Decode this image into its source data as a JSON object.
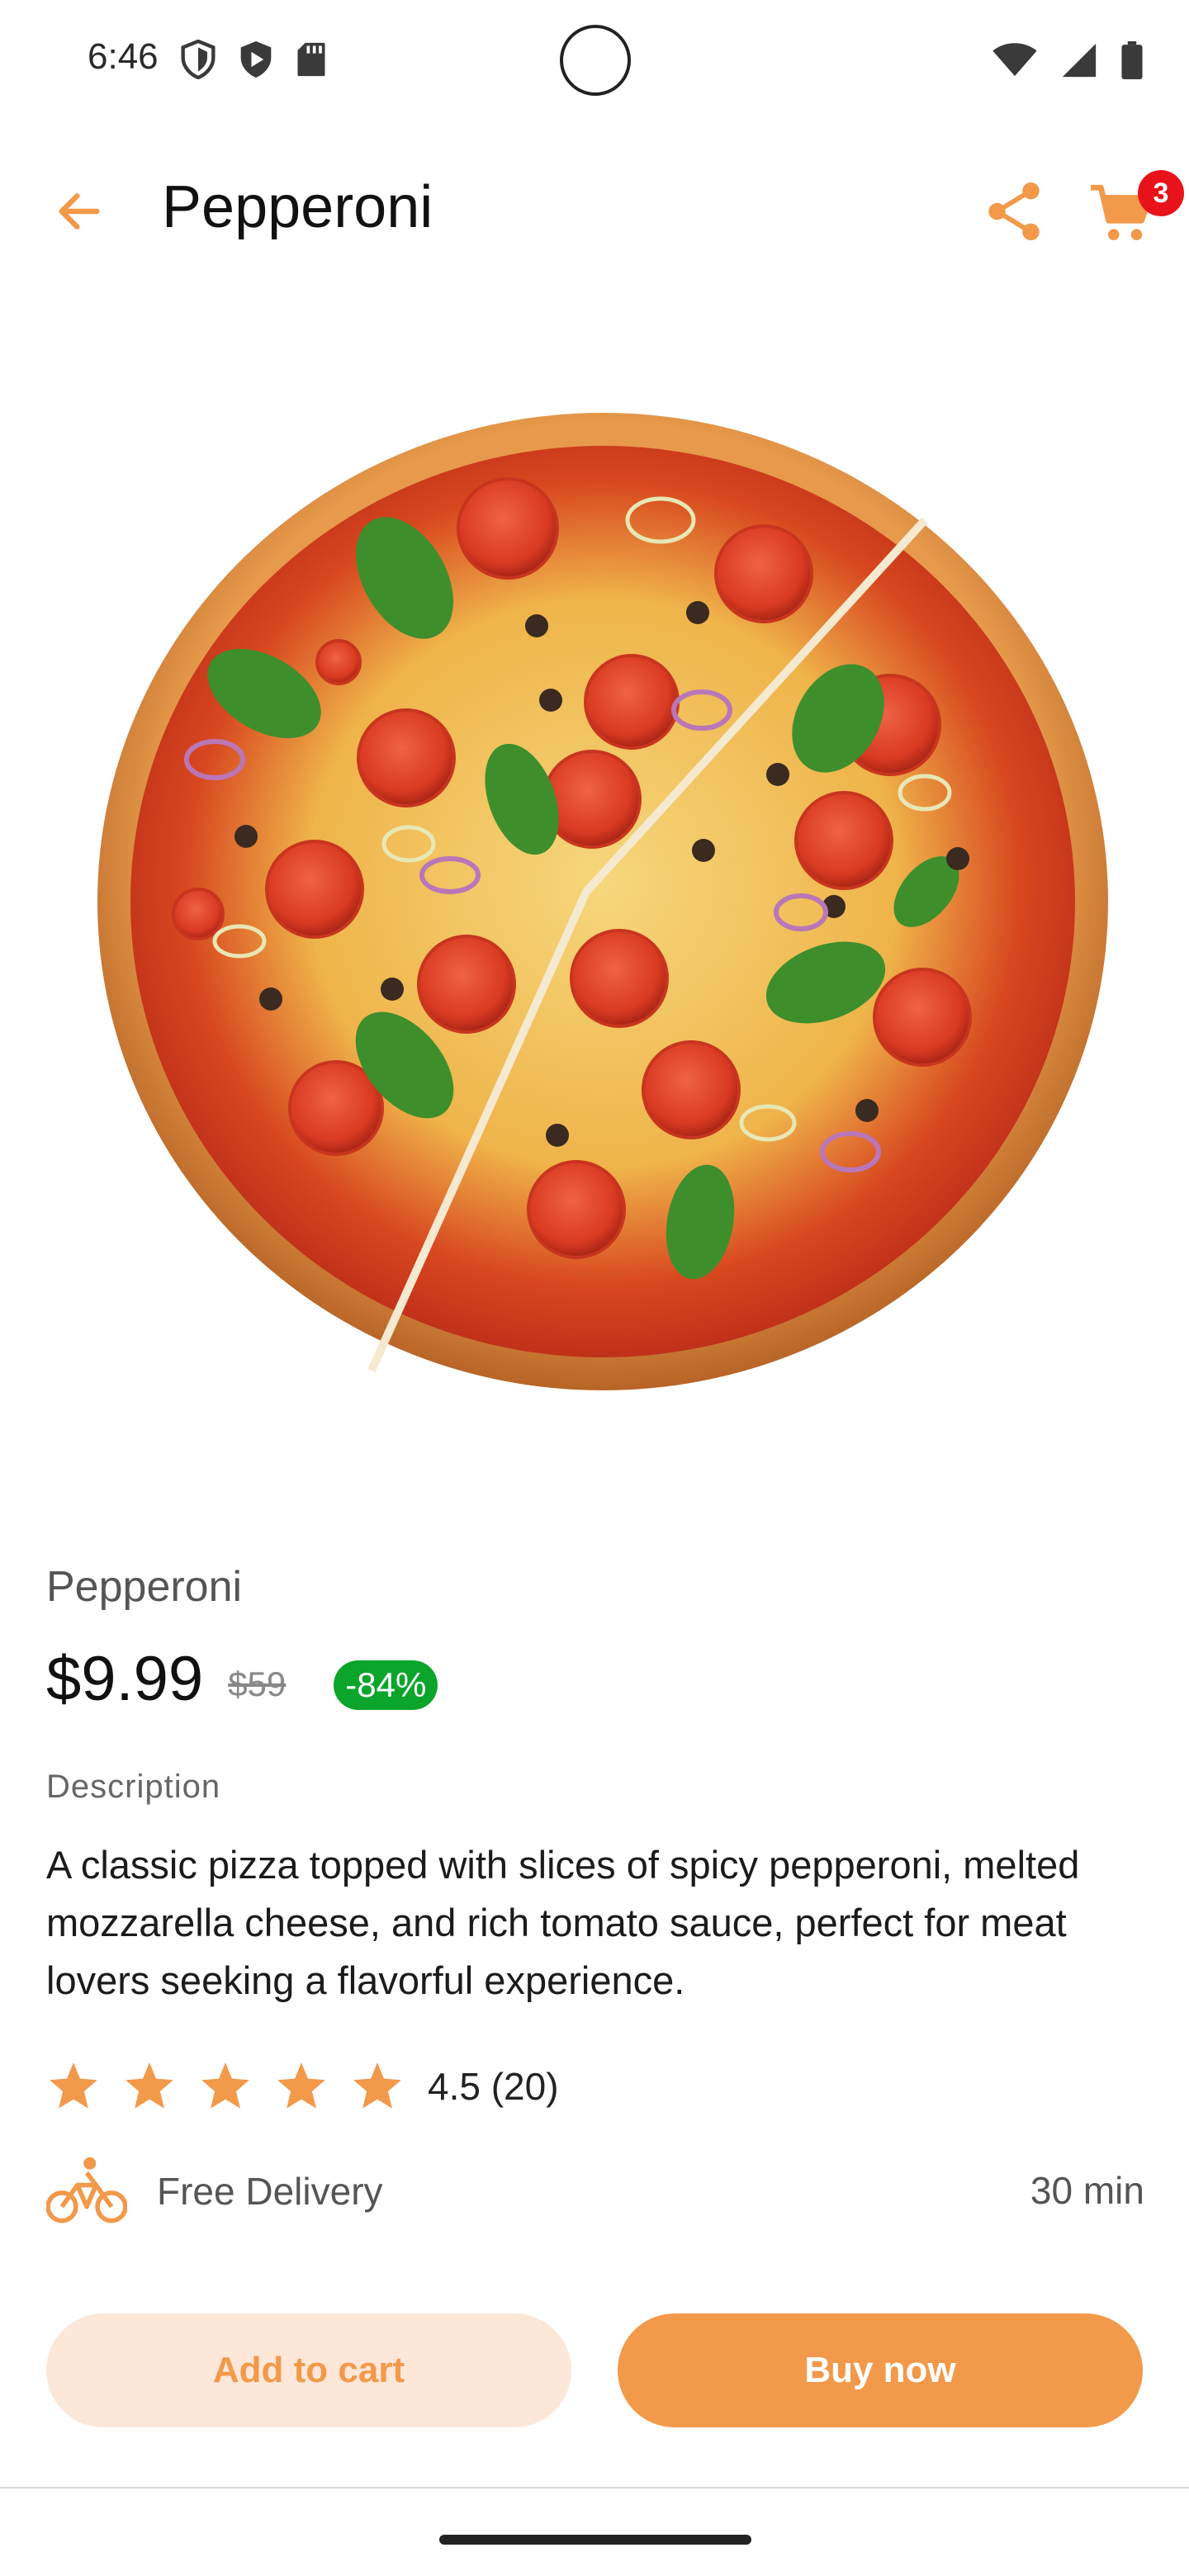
{
  "status_bar": {
    "time": "6:46",
    "left_icons": [
      "shield-outline-icon",
      "play-protect-icon",
      "sd-card-icon"
    ],
    "right_icons": [
      "wifi-icon",
      "cellular-signal-icon",
      "battery-icon"
    ]
  },
  "app_bar": {
    "title": "Pepperoni",
    "cart_count": "3"
  },
  "product": {
    "name": "Pepperoni",
    "price": "$9.99",
    "old_price": "$59",
    "discount": "-84%",
    "description_label": "Description",
    "description": "A classic pizza topped with slices of spicy pepperoni, melted mozzarella cheese, and rich tomato sauce, perfect for meat lovers seeking a flavorful experience.",
    "rating": 4.5,
    "rating_text": "4.5 (20)",
    "delivery": "Free Delivery",
    "delivery_time": "30 min"
  },
  "actions": {
    "add_to_cart": "Add to cart",
    "buy_now": "Buy now"
  },
  "colors": {
    "accent": "#f2994a",
    "accent_light": "#fde7d8",
    "discount_green": "#0aa52a",
    "badge_red": "#e8131a"
  }
}
